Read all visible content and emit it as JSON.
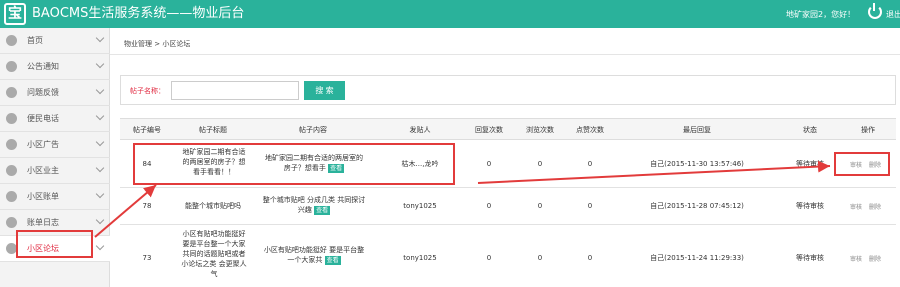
{
  "header": {
    "logo": "宝",
    "title": "BAOCMS生活服务系统——物业后台",
    "greeting": "地矿家园2，您好！",
    "logout": "退出"
  },
  "sidebar": {
    "items": [
      {
        "label": "首页",
        "icon": "home-icon"
      },
      {
        "label": "公告通知",
        "icon": "user-icon"
      },
      {
        "label": "问题反馈",
        "icon": "feedback-icon"
      },
      {
        "label": "便民电话",
        "icon": "phone-icon"
      },
      {
        "label": "小区广告",
        "icon": "ad-icon"
      },
      {
        "label": "小区业主",
        "icon": "users-icon"
      },
      {
        "label": "小区账单",
        "icon": "bill-icon"
      },
      {
        "label": "账单日志",
        "icon": "log-icon"
      },
      {
        "label": "小区论坛",
        "icon": "forum-icon"
      }
    ],
    "active_index": 8
  },
  "breadcrumb": "物业管理 > 小区论坛",
  "search": {
    "label": "帖子名称：",
    "value": "",
    "button": "搜 索"
  },
  "table": {
    "columns": [
      "帖子编号",
      "帖子标题",
      "帖子内容",
      "发贴人",
      "回复次数",
      "浏览次数",
      "点赞次数",
      "最后回复",
      "状态",
      "操作"
    ],
    "rows": [
      {
        "id": "84",
        "title_lines": [
          "地矿家园二期有合适",
          "的两居室的房子？想",
          "看手看看！！"
        ],
        "content_lines": [
          "地矿家园二期有合适的两居室的",
          "房子？想看手"
        ],
        "view": "查看",
        "author": "枯木...,龙吟",
        "replies": "0",
        "views": "0",
        "likes": "0",
        "last_reply": "自己(2015-11-30 13:57:46)",
        "status": "等待审核",
        "action_audit": "审核",
        "action_delete": "删除"
      },
      {
        "id": "78",
        "title_lines": [
          "能整个城市贴吧吗"
        ],
        "content_lines": [
          "整个城市贴吧 分成几类 共同探讨",
          "兴趣"
        ],
        "view": "查看",
        "author": "tony1025",
        "replies": "0",
        "views": "0",
        "likes": "0",
        "last_reply": "自己(2015-11-28 07:45:12)",
        "status": "等待审核",
        "action_audit": "审核",
        "action_delete": "删除"
      },
      {
        "id": "73",
        "title_lines": [
          "小区有贴吧功能挺好",
          "要是平台整一个大家",
          "共同的话题贴吧或者",
          "小论坛之类 会更聚人",
          "气"
        ],
        "content_lines": [
          "小区有贴吧功能挺好 要是平台整",
          "一个大家共"
        ],
        "view": "查看",
        "author": "tony1025",
        "replies": "0",
        "views": "0",
        "likes": "0",
        "last_reply": "自己(2015-11-24 11:29:33)",
        "status": "等待审核",
        "action_audit": "审核",
        "action_delete": "删除"
      }
    ]
  },
  "colors": {
    "brand": "#2ab29b",
    "annotation": "#e23b3b",
    "active_menu": "#e0283f"
  }
}
